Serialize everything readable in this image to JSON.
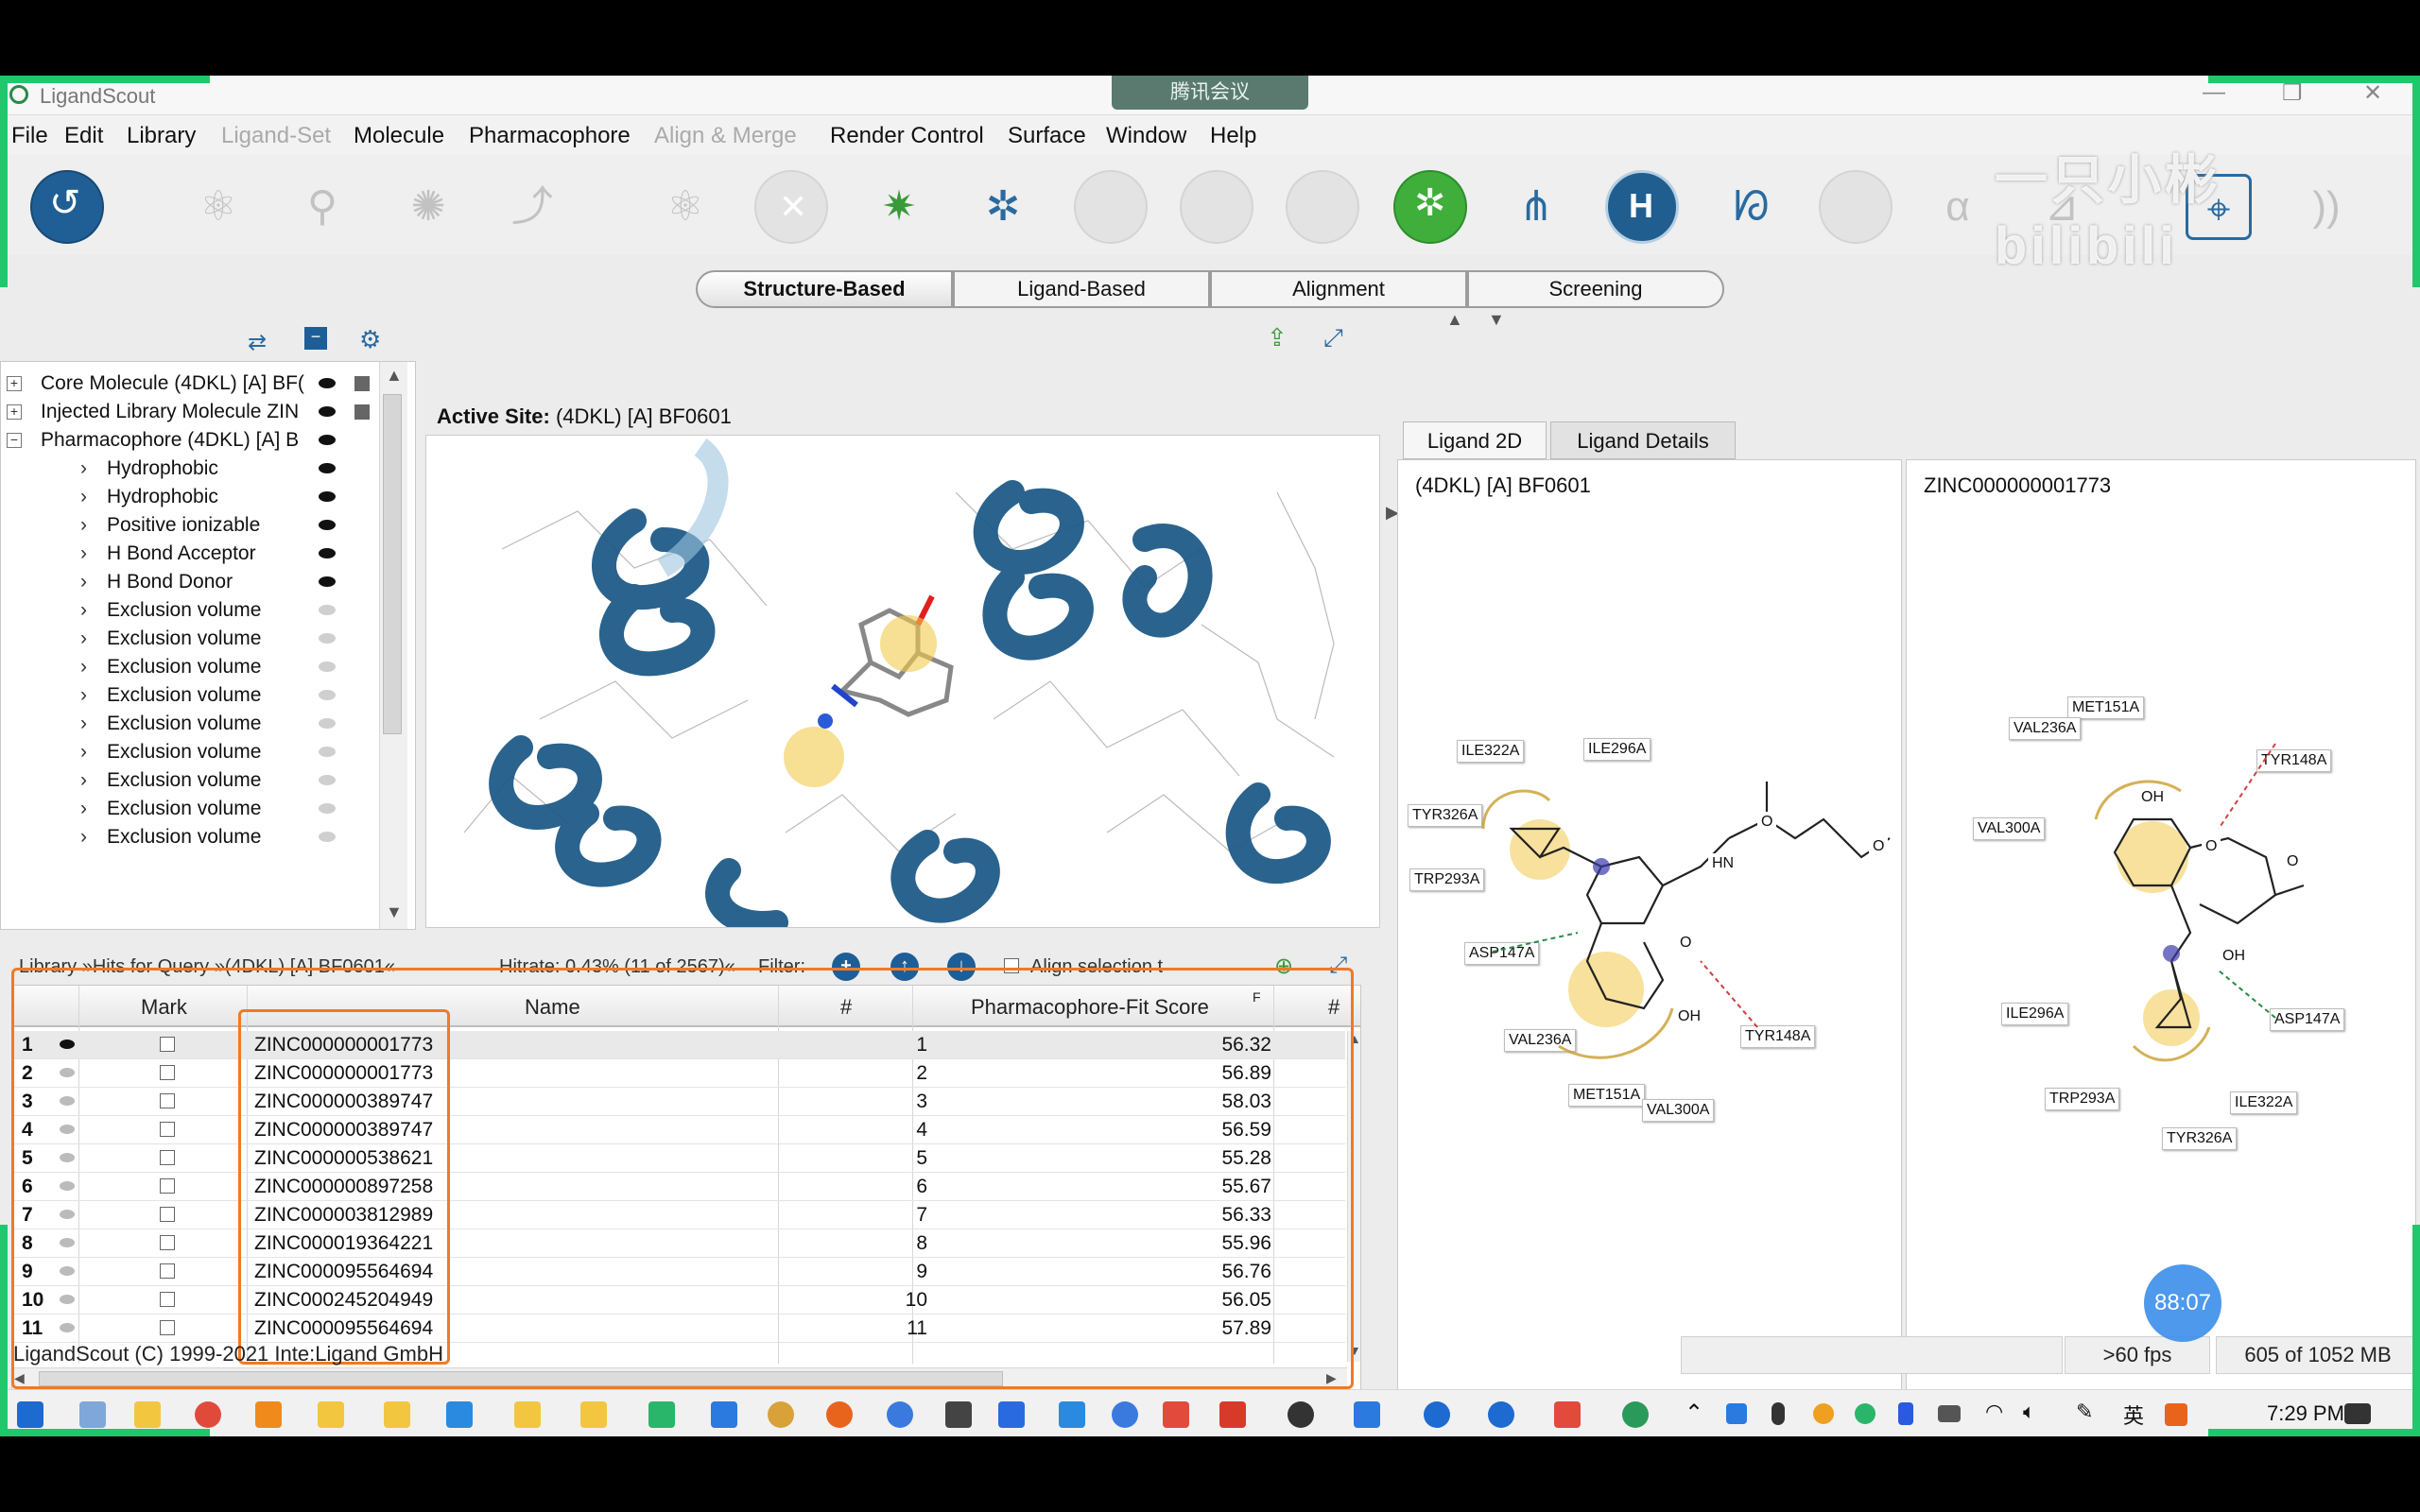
{
  "window": {
    "title": "LigandScout",
    "meeting_badge": "腾讯会议"
  },
  "menu": [
    {
      "label": "File",
      "enabled": true
    },
    {
      "label": "Edit",
      "enabled": true
    },
    {
      "label": "Library",
      "enabled": true
    },
    {
      "label": "Ligand-Set",
      "enabled": false
    },
    {
      "label": "Molecule",
      "enabled": true
    },
    {
      "label": "Pharmacophore",
      "enabled": true
    },
    {
      "label": "Align & Merge",
      "enabled": false
    },
    {
      "label": "Render Control",
      "enabled": true
    },
    {
      "label": "Surface",
      "enabled": true
    },
    {
      "label": "Window",
      "enabled": true
    },
    {
      "label": "Help",
      "enabled": true
    }
  ],
  "mode_tabs": [
    "Structure-Based",
    "Ligand-Based",
    "Alignment",
    "Screening"
  ],
  "active_mode": "Structure-Based",
  "tree": [
    {
      "label": "Core Molecule (4DKL) [A] BF(",
      "expander": "+",
      "visible": true
    },
    {
      "label": "Injected Library Molecule ZIN",
      "expander": "+",
      "visible": true
    },
    {
      "label": "Pharmacophore (4DKL) [A] B",
      "expander": "-",
      "visible": true
    },
    {
      "label": "Hydrophobic",
      "child": true,
      "visible": true
    },
    {
      "label": "Hydrophobic",
      "child": true,
      "visible": true
    },
    {
      "label": "Positive ionizable",
      "child": true,
      "visible": true
    },
    {
      "label": "H Bond Acceptor",
      "child": true,
      "visible": true
    },
    {
      "label": "H Bond Donor",
      "child": true,
      "visible": true
    },
    {
      "label": "Exclusion volume",
      "child": true,
      "visible": false
    },
    {
      "label": "Exclusion volume",
      "child": true,
      "visible": false
    },
    {
      "label": "Exclusion volume",
      "child": true,
      "visible": false
    },
    {
      "label": "Exclusion volume",
      "child": true,
      "visible": false
    },
    {
      "label": "Exclusion volume",
      "child": true,
      "visible": false
    },
    {
      "label": "Exclusion volume",
      "child": true,
      "visible": false
    },
    {
      "label": "Exclusion volume",
      "child": true,
      "visible": false
    },
    {
      "label": "Exclusion volume",
      "child": true,
      "visible": false
    },
    {
      "label": "Exclusion volume",
      "child": true,
      "visible": false
    }
  ],
  "viewer": {
    "label": "Active Site:",
    "site": "(4DKL) [A] BF0601"
  },
  "ligand_tabs": [
    "Ligand 2D",
    "Ligand Details"
  ],
  "ligand_left": {
    "title": "(4DKL) [A] BF0601",
    "residues": [
      "ILE322A",
      "ILE296A",
      "TYR326A",
      "TRP293A",
      "ASP147A",
      "VAL236A",
      "MET151A",
      "VAL300A",
      "TYR148A"
    ],
    "atoms": [
      "HN",
      "O",
      "O",
      "O",
      "OH"
    ]
  },
  "ligand_right": {
    "title": "ZINC000000001773",
    "residues": [
      "MET151A",
      "VAL236A",
      "TYR148A",
      "VAL300A",
      "ILE296A",
      "ASP147A",
      "TRP293A",
      "ILE322A",
      "TYR326A"
    ],
    "atoms": [
      "OH",
      "O",
      "O",
      "OH"
    ]
  },
  "library_bar": {
    "text": "Library »Hits for Query »(4DKL) [A] BF0601«",
    "hitrate": "Hitrate: 0.43% (11 of 2567)«",
    "filter_label": "Filter:",
    "align_label": "Align selection t"
  },
  "table": {
    "headers": {
      "mark": "Mark",
      "name": "Name",
      "index": "#",
      "score": "Pharmacophore-Fit Score",
      "flag": "F",
      "extra": "#"
    },
    "rows": [
      {
        "n": "1",
        "name": "ZINC000000001773",
        "idx": "1",
        "score": "56.32"
      },
      {
        "n": "2",
        "name": "ZINC000000001773",
        "idx": "2",
        "score": "56.89"
      },
      {
        "n": "3",
        "name": "ZINC000000389747",
        "idx": "3",
        "score": "58.03"
      },
      {
        "n": "4",
        "name": "ZINC000000389747",
        "idx": "4",
        "score": "56.59"
      },
      {
        "n": "5",
        "name": "ZINC000000538621",
        "idx": "5",
        "score": "55.28"
      },
      {
        "n": "6",
        "name": "ZINC000000897258",
        "idx": "6",
        "score": "55.67"
      },
      {
        "n": "7",
        "name": "ZINC000003812989",
        "idx": "7",
        "score": "56.33"
      },
      {
        "n": "8",
        "name": "ZINC000019364221",
        "idx": "8",
        "score": "55.96"
      },
      {
        "n": "9",
        "name": "ZINC000095564694",
        "idx": "9",
        "score": "56.76"
      },
      {
        "n": "10",
        "name": "ZINC000245204949",
        "idx": "10",
        "score": "56.05"
      },
      {
        "n": "11",
        "name": "ZINC000095564694",
        "idx": "11",
        "score": "57.89"
      }
    ]
  },
  "status": {
    "copyright": "LigandScout (C) 1999-2021 Inte:Ligand GmbH",
    "fps": ">60 fps",
    "memory": "605 of 1052 MB"
  },
  "overlay": {
    "timer": "88:07",
    "watermark": "一只小彬 bilibili"
  },
  "taskbar": {
    "clock": "7:29 PM",
    "ime": "英"
  },
  "colors": {
    "accent": "#1d5e98",
    "highlight": "#ef7a26",
    "hydrophobic": "#f2c94c",
    "ribbon": "#1f5b87"
  }
}
